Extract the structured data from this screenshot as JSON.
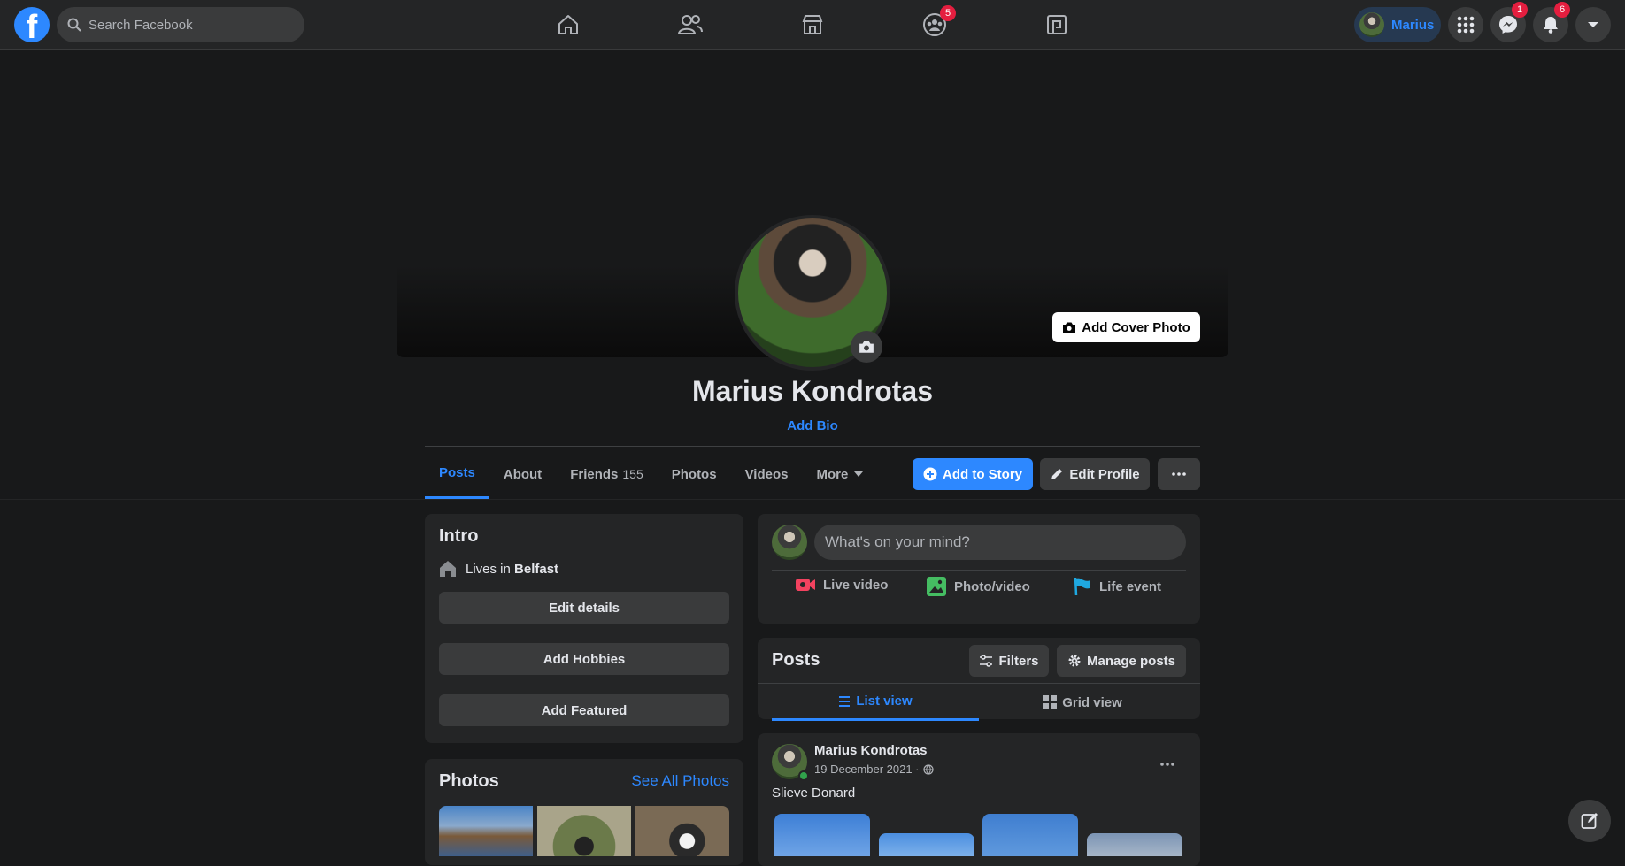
{
  "topbar": {
    "search_placeholder": "Search Facebook",
    "nav": [
      {
        "name": "home-icon"
      },
      {
        "name": "friends-icon"
      },
      {
        "name": "marketplace-icon"
      },
      {
        "name": "groups-icon",
        "badge": "5"
      },
      {
        "name": "gaming-icon"
      }
    ],
    "profile_name": "Marius",
    "messenger_badge": "1",
    "notifications_badge": "6"
  },
  "profile": {
    "add_cover_label": "Add Cover Photo",
    "name": "Marius Kondrotas",
    "add_bio_label": "Add Bio",
    "tabs": [
      {
        "label": "Posts",
        "active": true
      },
      {
        "label": "About"
      },
      {
        "label": "Friends",
        "count": "155"
      },
      {
        "label": "Photos"
      },
      {
        "label": "Videos"
      },
      {
        "label": "More"
      }
    ],
    "add_story_label": "Add to Story",
    "edit_profile_label": "Edit Profile"
  },
  "intro": {
    "title": "Intro",
    "lives_prefix": "Lives in",
    "lives_city": "Belfast",
    "edit_details_label": "Edit details",
    "add_hobbies_label": "Add Hobbies",
    "add_featured_label": "Add Featured"
  },
  "photos_card": {
    "title": "Photos",
    "see_all_label": "See All Photos"
  },
  "composer": {
    "placeholder": "What's on your mind?",
    "live_video": "Live video",
    "photo_video": "Photo/video",
    "life_event": "Life event"
  },
  "posts_header": {
    "title": "Posts",
    "filters_label": "Filters",
    "manage_label": "Manage posts",
    "list_view_label": "List view",
    "grid_view_label": "Grid view"
  },
  "post": {
    "author": "Marius Kondrotas",
    "date": "19 December 2021 ·",
    "text": "Slieve Donard"
  },
  "colors": {
    "accent": "#2d88ff",
    "background": "#18191a",
    "card": "#242526",
    "badge": "#e41e3f"
  }
}
